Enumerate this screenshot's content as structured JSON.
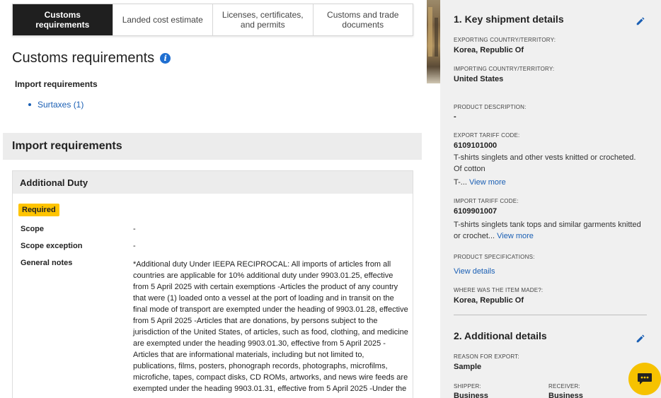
{
  "tabs": [
    {
      "label": "Customs\nrequirements",
      "active": true
    },
    {
      "label": "Landed cost estimate",
      "active": false
    },
    {
      "label": "Licenses, certificates,\nand permits",
      "active": false
    },
    {
      "label": "Customs and trade\ndocuments",
      "active": false
    }
  ],
  "main": {
    "title": "Customs requirements",
    "info_glyph": "i",
    "import_req_heading": "Import requirements",
    "surtaxes_link": "Surtaxes (1)",
    "section_band": "Import requirements",
    "duty": {
      "title": "Additional Duty",
      "badge": "Required",
      "scope_label": "Scope",
      "scope_value": "-",
      "scope_exception_label": "Scope exception",
      "scope_exception_value": "-",
      "notes_label": "General notes",
      "notes_value": "*Additional duty Under IEEPA RECIPROCAL: All imports of articles from all countries are applicable for 10% additional duty under 9903.01.25, effective from 5 April 2025 with certain exemptions -Articles the product of any country that were (1) loaded onto a vessel at the port of loading and in transit on the final mode of transport are exempted under the heading of 9903.01.28, effective from 5 April 2025 -Articles that are donations, by persons subject to the jurisdiction of the United States, of articles, such as food, clothing, and medicine are exempted under the heading 9903.01.30, effective from 5 April 2025 -Articles that are informational materials, including but not limited to, publications, films, posters, phonograph records, photographs, microfilms, microfiche, tapes, compact disks, CD ROMs, artworks, and news wire feeds are exempted under the heading 9903.01.31, effective from 5 April 2025 -Under the"
    }
  },
  "panel": {
    "key_title": "1. Key shipment details",
    "exporting_caption": "EXPORTING COUNTRY/TERRITORY:",
    "exporting_value": "Korea, Republic Of",
    "importing_caption": "IMPORTING COUNTRY/TERRITORY:",
    "importing_value": "United States",
    "product_desc_caption": "PRODUCT DESCRIPTION:",
    "product_desc_value": "-",
    "export_code_caption": "EXPORT TARIFF CODE:",
    "export_code_value": "6109101000",
    "export_code_desc": "T-shirts singlets and other vests knitted or crocheted. Of cotton",
    "export_code_desc2": "T-...",
    "export_view_more": "View more",
    "import_code_caption": "IMPORT TARIFF CODE:",
    "import_code_value": "6109901007",
    "import_code_desc": "T-shirts singlets tank tops and similar garments knitted or crochet...",
    "import_view_more": "View more",
    "specs_caption": "PRODUCT SPECIFICATIONS:",
    "specs_link": "View details",
    "made_caption": "WHERE WAS THE ITEM MADE?:",
    "made_value": "Korea, Republic Of",
    "additional_title": "2. Additional details",
    "reason_caption": "REASON FOR EXPORT:",
    "reason_value": "Sample",
    "shipper_caption": "SHIPPER:",
    "shipper_value": "Business",
    "receiver_caption": "RECEIVER:",
    "receiver_value": "Business"
  },
  "colors": {
    "accent": "#1a5fb4",
    "badge": "#ffc400",
    "chat": "#f6c200",
    "active_tab": "#1f1f1f"
  }
}
